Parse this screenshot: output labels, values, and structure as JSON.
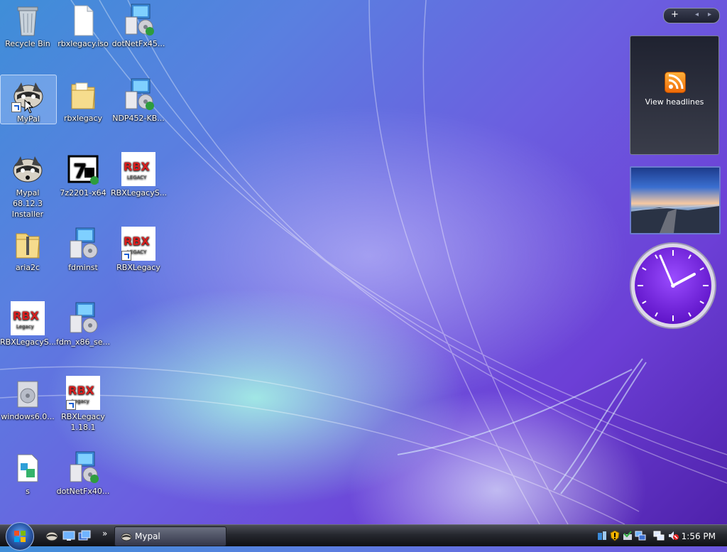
{
  "desktop": {
    "icons": [
      {
        "label": "Recycle Bin"
      },
      {
        "label": "rbxlegacy.iso"
      },
      {
        "label": "dotNetFx45..."
      },
      {
        "label": "MyPal"
      },
      {
        "label": "rbxlegacy"
      },
      {
        "label": "NDP452-KB..."
      },
      {
        "label": "Mypal 68.12.3 Installer"
      },
      {
        "label": "7z2201-x64"
      },
      {
        "label": "RBXLegacyS..."
      },
      {
        "label": "aria2c"
      },
      {
        "label": "fdminst"
      },
      {
        "label": "RBXLegacy"
      },
      {
        "label": "RBXLegacyS..."
      },
      {
        "label": "fdm_x86_se..."
      },
      {
        "label": "windows6.0..."
      },
      {
        "label": "RBXLegacy 1.18.1"
      },
      {
        "label": "s"
      },
      {
        "label": "dotNetFx40..."
      }
    ]
  },
  "sidebar": {
    "feed_gadget_label": "View headlines",
    "add_button": "+",
    "prev_button": "◂",
    "next_button": "▸"
  },
  "taskbar": {
    "task_label": "Mypal",
    "time": "1:56 PM"
  },
  "colors": {
    "rbx_red": "#d61f1f",
    "clock_purple": "#7a25e6"
  }
}
